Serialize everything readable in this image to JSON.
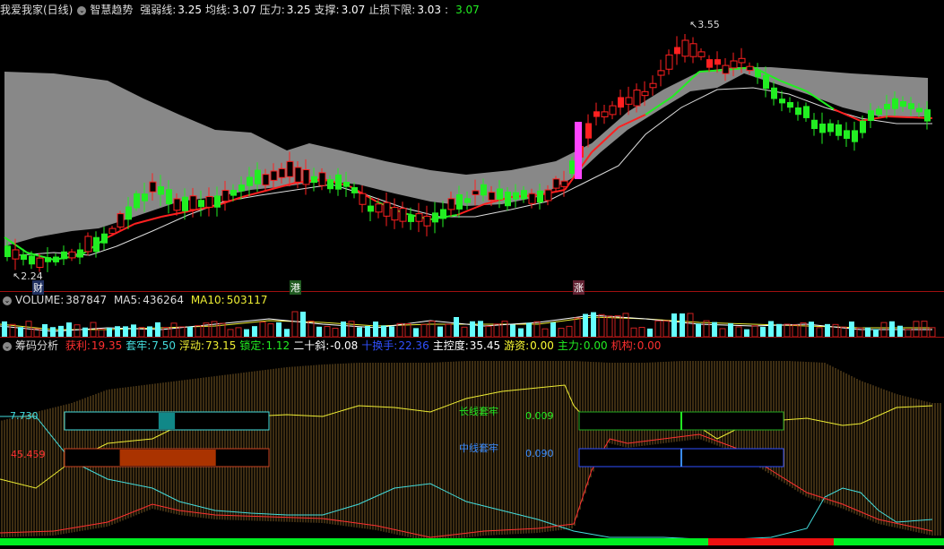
{
  "main_header": {
    "title": "我爱我家(日线)",
    "indicator": "智慧趋势",
    "items": [
      {
        "label": "强弱线:",
        "value": "3.25",
        "color": "#ffffff"
      },
      {
        "label": "均线:",
        "value": "3.07",
        "color": "#ffffff"
      },
      {
        "label": "压力:",
        "value": "3.25",
        "color": "#ffffff"
      },
      {
        "label": "支撑:",
        "value": "3.07",
        "color": "#ffffff"
      },
      {
        "label": "止损下限:",
        "value": "3.03",
        "color": "#ffffff"
      }
    ],
    "extra_value": "3.07",
    "extra_color": "#22ee22"
  },
  "price_labels": {
    "high": "3.55",
    "low": "2.24"
  },
  "markers": {
    "cai": "财",
    "gang": "港",
    "zhang": "涨"
  },
  "volume_header": {
    "title": "VOLUME:",
    "value": "387847",
    "ma5_label": "MA5:",
    "ma5": "436264",
    "ma10_label": "MA10:",
    "ma10": "503117"
  },
  "chip_header": {
    "title": "筹码分析",
    "items": [
      {
        "label": "获利:",
        "value": "19.35",
        "color": "#ff3030",
        "lcolor": "#ff3030"
      },
      {
        "label": "套牢:",
        "value": "7.50",
        "color": "#44dddd",
        "lcolor": "#44dddd"
      },
      {
        "label": "浮动:",
        "value": "73.15",
        "color": "#eeee33",
        "lcolor": "#eeee33"
      },
      {
        "label": "锁定:",
        "value": "1.12",
        "color": "#22ee22",
        "lcolor": "#22ee22"
      },
      {
        "label": "二十斜:",
        "value": "-0.08",
        "color": "#ffffff",
        "lcolor": "#ffffff"
      },
      {
        "label": "十换手:",
        "value": "22.36",
        "color": "#3050ff",
        "lcolor": "#3050ff"
      },
      {
        "label": "主控度:",
        "value": "35.45",
        "color": "#ffffff",
        "lcolor": "#ffffff"
      },
      {
        "label": "游资:",
        "value": "0.00",
        "color": "#ffff33",
        "lcolor": "#ffff33"
      },
      {
        "label": "主力:",
        "value": "0.00",
        "color": "#22ee22",
        "lcolor": "#22ee22"
      },
      {
        "label": "机构:",
        "value": "0.00",
        "color": "#ff3030",
        "lcolor": "#ff3030"
      }
    ]
  },
  "chip_panel": {
    "left_top_value": "7.730",
    "left_bottom_value": "45.459",
    "long_label": "长线套牢",
    "long_value": "0.009",
    "mid_label": "中线套牢",
    "mid_value": "0.090",
    "left_cyan_fill": 0.12,
    "left_orange_fill": 0.47,
    "right_green_fill": 0.49,
    "right_blue_fill": 0.49
  },
  "colors": {
    "up": "#ff2020",
    "down": "#22ee22",
    "cloud": "#888888",
    "vol_up": "#cc2020",
    "vol_down": "#66ffff",
    "magenta": "#ff44ff"
  }
}
